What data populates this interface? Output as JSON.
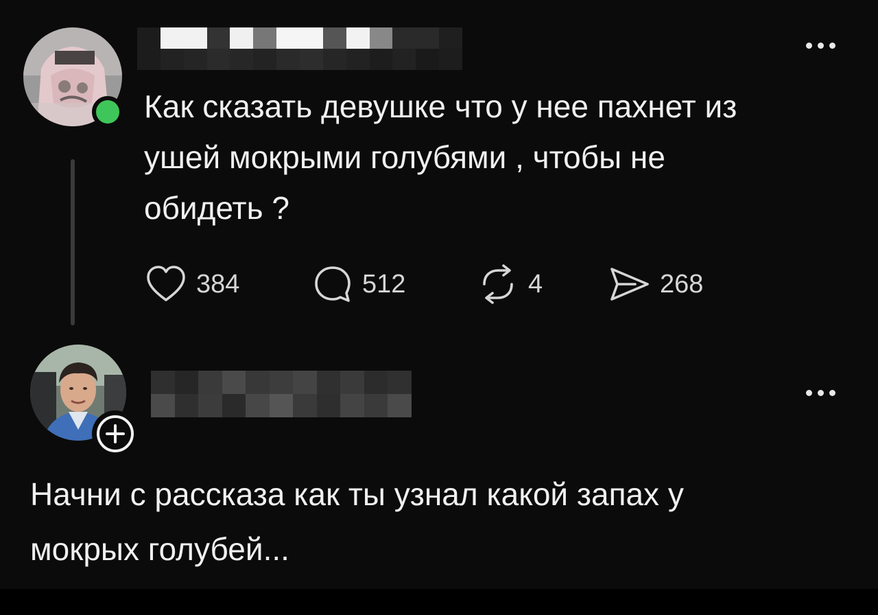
{
  "thread": {
    "post": {
      "text_line1": "Как сказать девушке что у нее пахнет из",
      "text_line2": "ушей мокрыми голубями , чтобы не",
      "text_line3": "обидеть ?",
      "stats": {
        "likes": "384",
        "comments": "512",
        "reposts": "4",
        "shares": "268"
      },
      "icons": {
        "like": "heart-icon",
        "comment": "speech-bubble-icon",
        "repost": "repost-arrows-icon",
        "share": "send-arrow-icon",
        "more": "more-dots-icon",
        "status": "online-status-dot"
      }
    },
    "reply": {
      "text_line1": "Начни с рассказа как ты узнал какой запах у",
      "text_line2": "мокрых голубей...",
      "icons": {
        "follow": "plus-icon",
        "more": "more-dots-icon"
      }
    }
  },
  "colors": {
    "background": "#0b0b0b",
    "text": "#f0f0f0",
    "muted": "#d6d6d6",
    "online": "#3fc65a",
    "thread_line": "#3a3a3a"
  }
}
